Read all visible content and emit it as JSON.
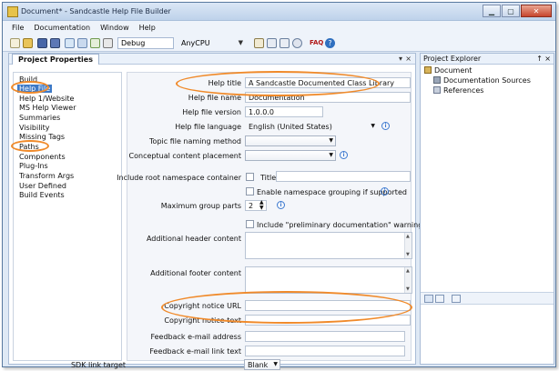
{
  "window": {
    "title": "Document* - Sandcastle Help File Builder"
  },
  "menu": [
    "File",
    "Documentation",
    "Window",
    "Help"
  ],
  "toolbar": {
    "config": "Debug",
    "platform": "AnyCPU",
    "faq": "FAQ"
  },
  "project_properties": {
    "tab": "Project Properties",
    "pin": "▾",
    "close": "×",
    "categories": [
      "Build",
      "Help File",
      "Help 1/Website",
      "MS Help Viewer",
      "Summaries",
      "Visibility",
      "Missing Tags",
      "Paths",
      "Components",
      "Plug-Ins",
      "Transform Args",
      "User Defined",
      "Build Events"
    ],
    "selected_category": "Help File",
    "labels": {
      "help_title": "Help title",
      "help_file_name": "Help file name",
      "help_file_version": "Help file version",
      "help_file_language": "Help file language",
      "topic_naming": "Topic file naming method",
      "content_placement": "Conceptual content placement",
      "root_ns": "Include root namespace container",
      "title_label": "Title",
      "ns_grouping": "Enable namespace grouping if supported",
      "max_group": "Maximum group parts",
      "prelim": "Include \"preliminary documentation\" warning",
      "header": "Additional header content",
      "footer": "Additional footer content",
      "copyright_url": "Copyright notice URL",
      "copyright_text": "Copyright notice text",
      "feedback_email": "Feedback e-mail address",
      "feedback_link": "Feedback e-mail link text",
      "sdk_target": "SDK link target"
    },
    "values": {
      "help_title": "A Sandcastle Documented Class Library",
      "help_file_name": "Documentation",
      "help_file_version": "1.0.0.0",
      "help_file_language": "English (United States)",
      "topic_naming": "",
      "content_placement": "",
      "title_value": "",
      "max_group": "2",
      "copyright_url": "",
      "copyright_text": "",
      "feedback_email": "",
      "feedback_link": "",
      "sdk_target": "Blank"
    }
  },
  "project_explorer": {
    "title": "Project Explorer",
    "pin": "↑",
    "close": "×",
    "items": [
      "Document",
      "Documentation Sources",
      "References"
    ]
  }
}
